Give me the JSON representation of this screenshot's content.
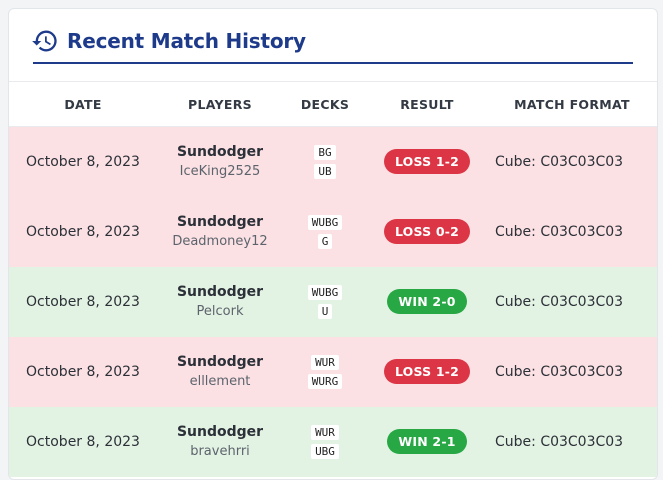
{
  "header": {
    "title": "Recent Match History",
    "icon": "history-icon",
    "accent": "#1d3b8a"
  },
  "columns": [
    "DATE",
    "PLAYERS",
    "DECKS",
    "RESULT",
    "MATCH FORMAT"
  ],
  "colors": {
    "loss_row": "#fbe1e3",
    "win_row": "#e3f3e3",
    "loss_badge": "#dc3545",
    "win_badge": "#28a745"
  },
  "matches": [
    {
      "date": "October 8, 2023",
      "player1": "Sundodger",
      "player2": "IceKing2525",
      "deck1": "BG",
      "deck2": "UB",
      "outcome": "loss",
      "result": "LOSS 1-2",
      "format": "Cube: C03C03C03"
    },
    {
      "date": "October 8, 2023",
      "player1": "Sundodger",
      "player2": "Deadmoney12",
      "deck1": "WUBG",
      "deck2": "G",
      "outcome": "loss",
      "result": "LOSS 0-2",
      "format": "Cube: C03C03C03"
    },
    {
      "date": "October 8, 2023",
      "player1": "Sundodger",
      "player2": "Pelcork",
      "deck1": "WUBG",
      "deck2": "U",
      "outcome": "win",
      "result": "WIN 2-0",
      "format": "Cube: C03C03C03"
    },
    {
      "date": "October 8, 2023",
      "player1": "Sundodger",
      "player2": "elllement",
      "deck1": "WUR",
      "deck2": "WURG",
      "outcome": "loss",
      "result": "LOSS 1-2",
      "format": "Cube: C03C03C03"
    },
    {
      "date": "October 8, 2023",
      "player1": "Sundodger",
      "player2": "bravehrri",
      "deck1": "WUR",
      "deck2": "UBG",
      "outcome": "win",
      "result": "WIN 2-1",
      "format": "Cube: C03C03C03"
    }
  ]
}
